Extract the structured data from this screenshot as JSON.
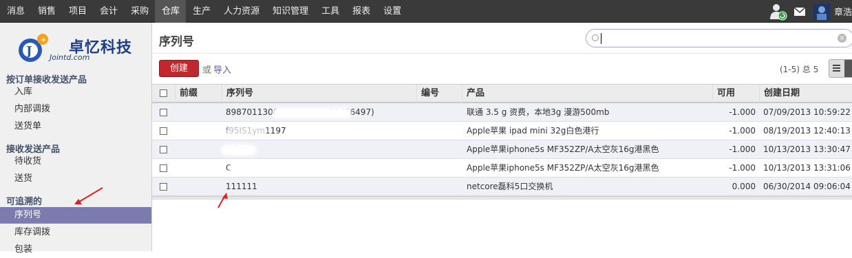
{
  "topbar": {
    "menu": [
      "消息",
      "销售",
      "项目",
      "会计",
      "采购",
      "仓库",
      "生产",
      "人力资源",
      "知识管理",
      "工具",
      "报表",
      "设置"
    ],
    "active_index": 5,
    "user_name": "章浩"
  },
  "sidebar": {
    "logo_name": "卓忆科技",
    "logo_url": "Jointd.com",
    "sections": [
      {
        "title": "按订单接收发送产品",
        "items": [
          "入库",
          "内部调拨",
          "送货单"
        ]
      },
      {
        "title": "接收发送产品",
        "items": [
          "待收货",
          "送货"
        ]
      },
      {
        "title": "可追溯的",
        "items": [
          "序列号",
          "库存调拨",
          "包装"
        ]
      }
    ],
    "active_item": "序列号"
  },
  "header": {
    "title": "序列号",
    "search_value": ""
  },
  "toolbar": {
    "create_label": "创建",
    "or_label": "或",
    "import_label": "导入",
    "pager": "(1-5) 总 5"
  },
  "table": {
    "columns": [
      "前缀",
      "序列号",
      "编号",
      "产品",
      "可用",
      "创建日期"
    ],
    "rows": [
      {
        "prefix": "",
        "serial": "8987011300",
        "serial_tail": "51656497)",
        "ref": "",
        "product": "联通 3.5 g 资费，本地3g 漫游500mb",
        "available": "-1.000",
        "date": "07/09/2013 10:59:22"
      },
      {
        "prefix": "",
        "serial": "f95IS1ym1197",
        "serial_tail": "",
        "ref": "",
        "product": "Apple苹果 ipad mini 32g白色港行",
        "available": "-1.000",
        "date": "08/19/2013 12:40:13"
      },
      {
        "prefix": "",
        "serial": "       rc4",
        "serial_tail": "",
        "ref": "",
        "product": "Apple苹果iphone5s MF352ZP/A太空灰16g港黑色",
        "available": "-1.000",
        "date": "10/13/2013 13:30:47"
      },
      {
        "prefix": "",
        "serial": "C",
        "serial_tail": "",
        "ref": "",
        "product": "Apple苹果iphone5s MF352ZP/A太空灰16g港黑色",
        "available": "-1.000",
        "date": "10/13/2013 13:31:06"
      },
      {
        "prefix": "",
        "serial": "111111",
        "serial_tail": "",
        "ref": "",
        "product": "netcore磊科5口交换机",
        "available": "0.000",
        "date": "06/30/2014 09:06:04"
      }
    ]
  },
  "colors": {
    "topbar_bg": "#3a3a3a",
    "create_button": "#c0282d",
    "active_sidebar": "#7c7bad",
    "annotation_arrow": "#e02020"
  }
}
